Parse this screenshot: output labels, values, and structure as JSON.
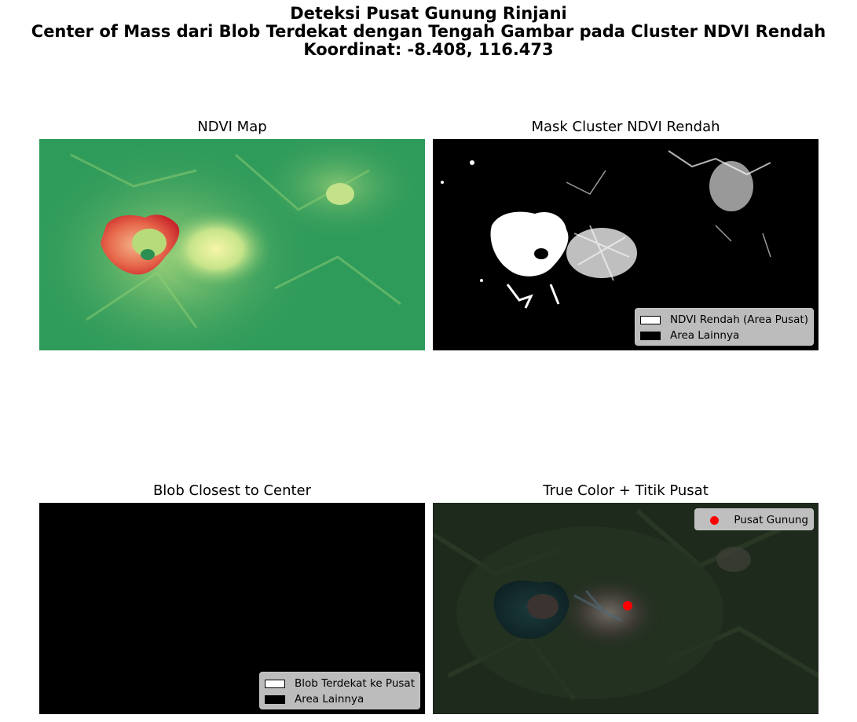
{
  "figure": {
    "title_line1": "Deteksi Pusat Gunung Rinjani",
    "title_line2": "Center of Mass dari Blob Terdekat dengan Tengah Gambar pada Cluster NDVI Rendah",
    "title_line3": "Koordinat: -8.408, 116.473"
  },
  "panels": {
    "ndvi": {
      "title": "NDVI Map",
      "colormap": "RdYlGn"
    },
    "mask": {
      "title": "Mask Cluster NDVI Rendah",
      "legend": [
        {
          "label": "NDVI Rendah (Area Pusat)",
          "color": "#ffffff"
        },
        {
          "label": "Area Lainnya",
          "color": "#000000"
        }
      ]
    },
    "blob": {
      "title": "Blob Closest to Center",
      "legend": [
        {
          "label": "Blob Terdekat ke Pusat",
          "color": "#ffffff"
        },
        {
          "label": "Area Lainnya",
          "color": "#000000"
        }
      ]
    },
    "truecolor": {
      "title": "True Color + Titik Pusat",
      "legend": [
        {
          "label": "Pusat Gunung",
          "color": "#ff0000",
          "marker": "dot"
        }
      ]
    }
  }
}
